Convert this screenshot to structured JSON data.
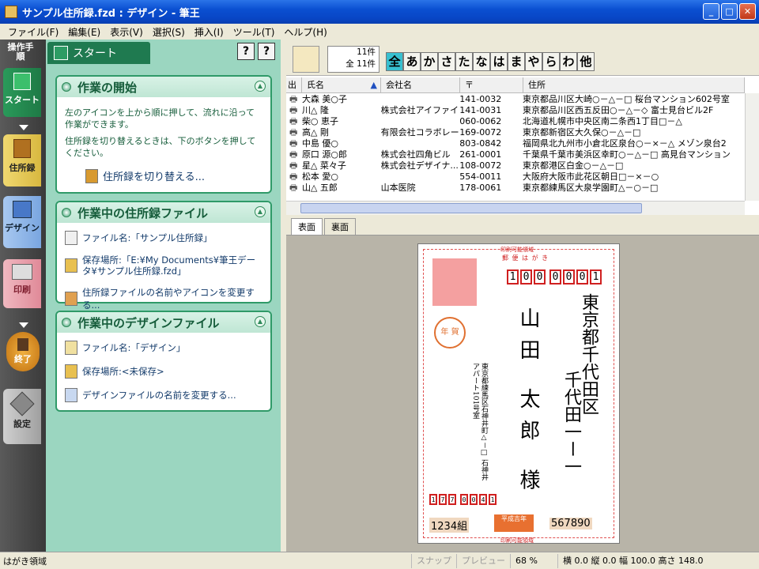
{
  "window": {
    "title": "サンプル住所録.fzd : デザイン - 筆王"
  },
  "menu": [
    "ファイル(F)",
    "編集(E)",
    "表示(V)",
    "選択(S)",
    "挿入(I)",
    "ツール(T)",
    "ヘルプ(H)"
  ],
  "nav": {
    "header": "操作手順",
    "items": [
      {
        "label": "スタート"
      },
      {
        "label": "住所録"
      },
      {
        "label": "デザイン"
      },
      {
        "label": "印刷"
      },
      {
        "label": "終了"
      },
      {
        "label": "設定"
      }
    ]
  },
  "taskpane": {
    "tab_label": "スタート",
    "help_buttons": [
      "?",
      "?"
    ],
    "panels": [
      {
        "title": "作業の開始",
        "text1": "左のアイコンを上から順に押して、流れに沿って作業ができます。",
        "text2": "住所録を切り替えるときは、下のボタンを押してください。",
        "link": "住所録を切り替える..."
      },
      {
        "title": "作業中の住所録ファイル",
        "links": [
          "ファイル名:「サンプル住所録」",
          "保存場所:「E:¥My Documents¥筆王データ¥サンプル住所録.fzd」",
          "住所録ファイルの名前やアイコンを変更する..."
        ]
      },
      {
        "title": "作業中のデザインファイル",
        "links": [
          "ファイル名:「デザイン」",
          "保存場所:<未保存>",
          "デザインファイルの名前を変更する..."
        ]
      }
    ]
  },
  "address_book": {
    "count": "11件",
    "total": "全 11件",
    "kana_tabs": [
      "全",
      "あ",
      "か",
      "さ",
      "た",
      "な",
      "は",
      "ま",
      "や",
      "ら",
      "わ",
      "他"
    ],
    "selected_kana": "全",
    "columns": [
      "出",
      "氏名",
      "会社名",
      "〒",
      "住所"
    ],
    "rows": [
      {
        "name": "大森 美○子",
        "company": "",
        "zip": "141-0032",
        "address": "東京都品川区大崎○－△－□ 桜台マンション602号室"
      },
      {
        "name": "川△ 隆",
        "company": "株式会社アイファイブ",
        "zip": "141-0031",
        "address": "東京都品川区西五反田○－△－◇ 富士見台ビル2F"
      },
      {
        "name": "柴○ 恵子",
        "company": "",
        "zip": "060-0062",
        "address": "北海道札幌市中央区南二条西1丁目□－△"
      },
      {
        "name": "高△ 剛",
        "company": "有限会社コラボレー...",
        "zip": "169-0072",
        "address": "東京都新宿区大久保○－△－□"
      },
      {
        "name": "中島 優○",
        "company": "",
        "zip": "803-0842",
        "address": "福岡県北九州市小倉北区泉台○－×－△ メゾン泉台2"
      },
      {
        "name": "原口 源○郎",
        "company": "株式会社四角ビル",
        "zip": "261-0001",
        "address": "千葉県千葉市美浜区幸町○－△－□ 高見台マンション"
      },
      {
        "name": "星△ 菜々子",
        "company": "株式会社デザイナ...",
        "zip": "108-0072",
        "address": "東京都港区白金○－△－□"
      },
      {
        "name": "松本 愛○",
        "company": "",
        "zip": "554-0011",
        "address": "大阪府大阪市此花区朝日□－×－○"
      },
      {
        "name": "山△ 五郎",
        "company": "山本医院",
        "zip": "178-0061",
        "address": "東京都練馬区大泉学園町△－○－□"
      }
    ]
  },
  "preview": {
    "tabs": [
      "表面",
      "裏面"
    ],
    "active_tab": "表面",
    "postcard": {
      "header_line1": "印刷可能領域",
      "header_line2": "郵 便 は が き",
      "footer": "印刷可能領域",
      "stamp_label": "年 賀",
      "to_zip": [
        "1",
        "0",
        "0",
        "0",
        "0",
        "0",
        "1"
      ],
      "to_address": "東京都千代田区",
      "to_address2": "千代田一ー一",
      "to_name": "山田 太郎 様",
      "from_zip": [
        "1",
        "7",
        "7",
        "0",
        "0",
        "4",
        "1"
      ],
      "from_address": "東京都練馬区石神井町△－□ 石神井アパート101号室",
      "lottery_left": "1234組",
      "lottery_center": "平成吉年",
      "lottery_right": "567890"
    }
  },
  "status": {
    "left": "はがき領域",
    "snap": "スナップ",
    "mode": "プレビュー",
    "zoom": "68 %",
    "coords": "横 0.0 縦 0.0 幅 100.0 高さ 148.0"
  }
}
